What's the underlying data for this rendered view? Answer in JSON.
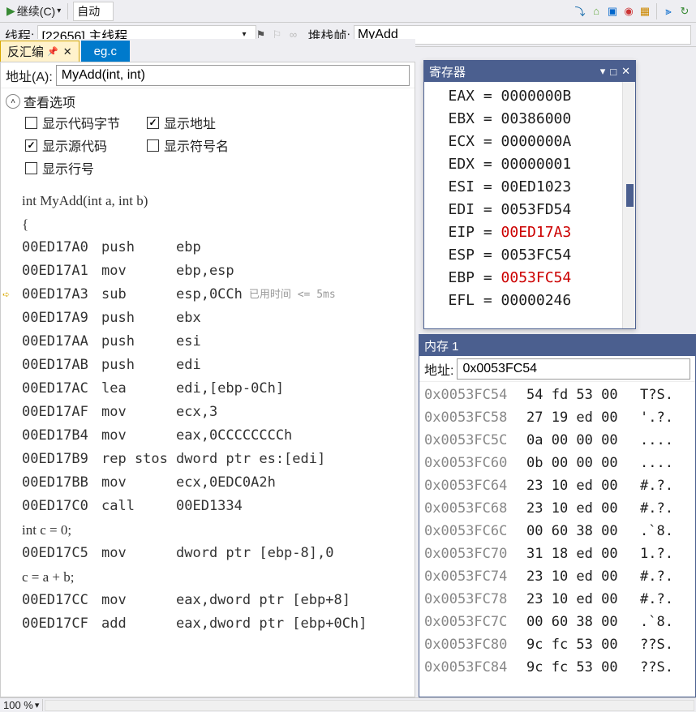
{
  "toolbar": {
    "continue_label": "继续(C)",
    "auto_label": "自动"
  },
  "row2": {
    "thread_label": "线程:",
    "thread_value": "[22656] 主线程",
    "stackframe_label": "堆栈帧:",
    "stackframe_value": "MyAdd"
  },
  "disasm": {
    "tab_name": "反汇编",
    "file_tab": "eg.c",
    "address_label": "地址(A):",
    "address_value": "MyAdd(int, int)",
    "view_options_label": "查看选项",
    "opt_show_code_bytes": "显示代码字节",
    "opt_show_address": "显示地址",
    "opt_show_source": "显示源代码",
    "opt_show_symbol": "显示符号名",
    "opt_show_lineno": "显示行号",
    "timing_label": "已用时间 <= 5ms",
    "lines": [
      {
        "type": "src",
        "text": "int MyAdd(int a, int b)"
      },
      {
        "type": "src",
        "text": "{"
      },
      {
        "type": "asm",
        "addr": "00ED17A0",
        "op": "push",
        "args": "ebp"
      },
      {
        "type": "asm",
        "addr": "00ED17A1",
        "op": "mov",
        "args": "ebp,esp"
      },
      {
        "type": "asm",
        "addr": "00ED17A3",
        "op": "sub",
        "args": "esp,0CCh",
        "current": true,
        "timing": true
      },
      {
        "type": "asm",
        "addr": "00ED17A9",
        "op": "push",
        "args": "ebx"
      },
      {
        "type": "asm",
        "addr": "00ED17AA",
        "op": "push",
        "args": "esi"
      },
      {
        "type": "asm",
        "addr": "00ED17AB",
        "op": "push",
        "args": "edi"
      },
      {
        "type": "asm",
        "addr": "00ED17AC",
        "op": "lea",
        "args": "edi,[ebp-0Ch]"
      },
      {
        "type": "asm",
        "addr": "00ED17AF",
        "op": "mov",
        "args": "ecx,3"
      },
      {
        "type": "asm",
        "addr": "00ED17B4",
        "op": "mov",
        "args": "eax,0CCCCCCCCh"
      },
      {
        "type": "asm",
        "addr": "00ED17B9",
        "op": "rep stos",
        "args": "dword ptr es:[edi]"
      },
      {
        "type": "asm",
        "addr": "00ED17BB",
        "op": "mov",
        "args": "ecx,0EDC0A2h"
      },
      {
        "type": "asm",
        "addr": "00ED17C0",
        "op": "call",
        "args": "00ED1334"
      },
      {
        "type": "src",
        "text": "    int c = 0;"
      },
      {
        "type": "asm",
        "addr": "00ED17C5",
        "op": "mov",
        "args": "dword ptr [ebp-8],0"
      },
      {
        "type": "src",
        "text": "    c = a + b;"
      },
      {
        "type": "asm",
        "addr": "00ED17CC",
        "op": "mov",
        "args": "eax,dword ptr [ebp+8]"
      },
      {
        "type": "asm",
        "addr": "00ED17CF",
        "op": "add",
        "args": "eax,dword ptr [ebp+0Ch]"
      }
    ]
  },
  "registers": {
    "title": "寄存器",
    "items": [
      {
        "name": "EAX",
        "val": "0000000B"
      },
      {
        "name": "EBX",
        "val": "00386000"
      },
      {
        "name": "ECX",
        "val": "0000000A"
      },
      {
        "name": "EDX",
        "val": "00000001"
      },
      {
        "name": "ESI",
        "val": "00ED1023"
      },
      {
        "name": "EDI",
        "val": "0053FD54"
      },
      {
        "name": "EIP",
        "val": "00ED17A3",
        "changed": true
      },
      {
        "name": "ESP",
        "val": "0053FC54"
      },
      {
        "name": "EBP",
        "val": "0053FC54",
        "changed": true
      },
      {
        "name": "EFL",
        "val": "00000246"
      }
    ]
  },
  "memory": {
    "title": "内存 1",
    "address_label": "地址:",
    "address_value": "0x0053FC54",
    "rows": [
      {
        "addr": "0x0053FC54",
        "hex": "54 fd 53 00",
        "ascii": "T?S."
      },
      {
        "addr": "0x0053FC58",
        "hex": "27 19 ed 00",
        "ascii": "'.?."
      },
      {
        "addr": "0x0053FC5C",
        "hex": "0a 00 00 00",
        "ascii": "...."
      },
      {
        "addr": "0x0053FC60",
        "hex": "0b 00 00 00",
        "ascii": "...."
      },
      {
        "addr": "0x0053FC64",
        "hex": "23 10 ed 00",
        "ascii": "#.?."
      },
      {
        "addr": "0x0053FC68",
        "hex": "23 10 ed 00",
        "ascii": "#.?."
      },
      {
        "addr": "0x0053FC6C",
        "hex": "00 60 38 00",
        "ascii": ".`8."
      },
      {
        "addr": "0x0053FC70",
        "hex": "31 18 ed 00",
        "ascii": "1.?."
      },
      {
        "addr": "0x0053FC74",
        "hex": "23 10 ed 00",
        "ascii": "#.?."
      },
      {
        "addr": "0x0053FC78",
        "hex": "23 10 ed 00",
        "ascii": "#.?."
      },
      {
        "addr": "0x0053FC7C",
        "hex": "00 60 38 00",
        "ascii": ".`8."
      },
      {
        "addr": "0x0053FC80",
        "hex": "9c fc 53 00",
        "ascii": "??S."
      },
      {
        "addr": "0x0053FC84",
        "hex": "9c fc 53 00",
        "ascii": "??S."
      }
    ]
  },
  "status": {
    "zoom": "100 %"
  }
}
